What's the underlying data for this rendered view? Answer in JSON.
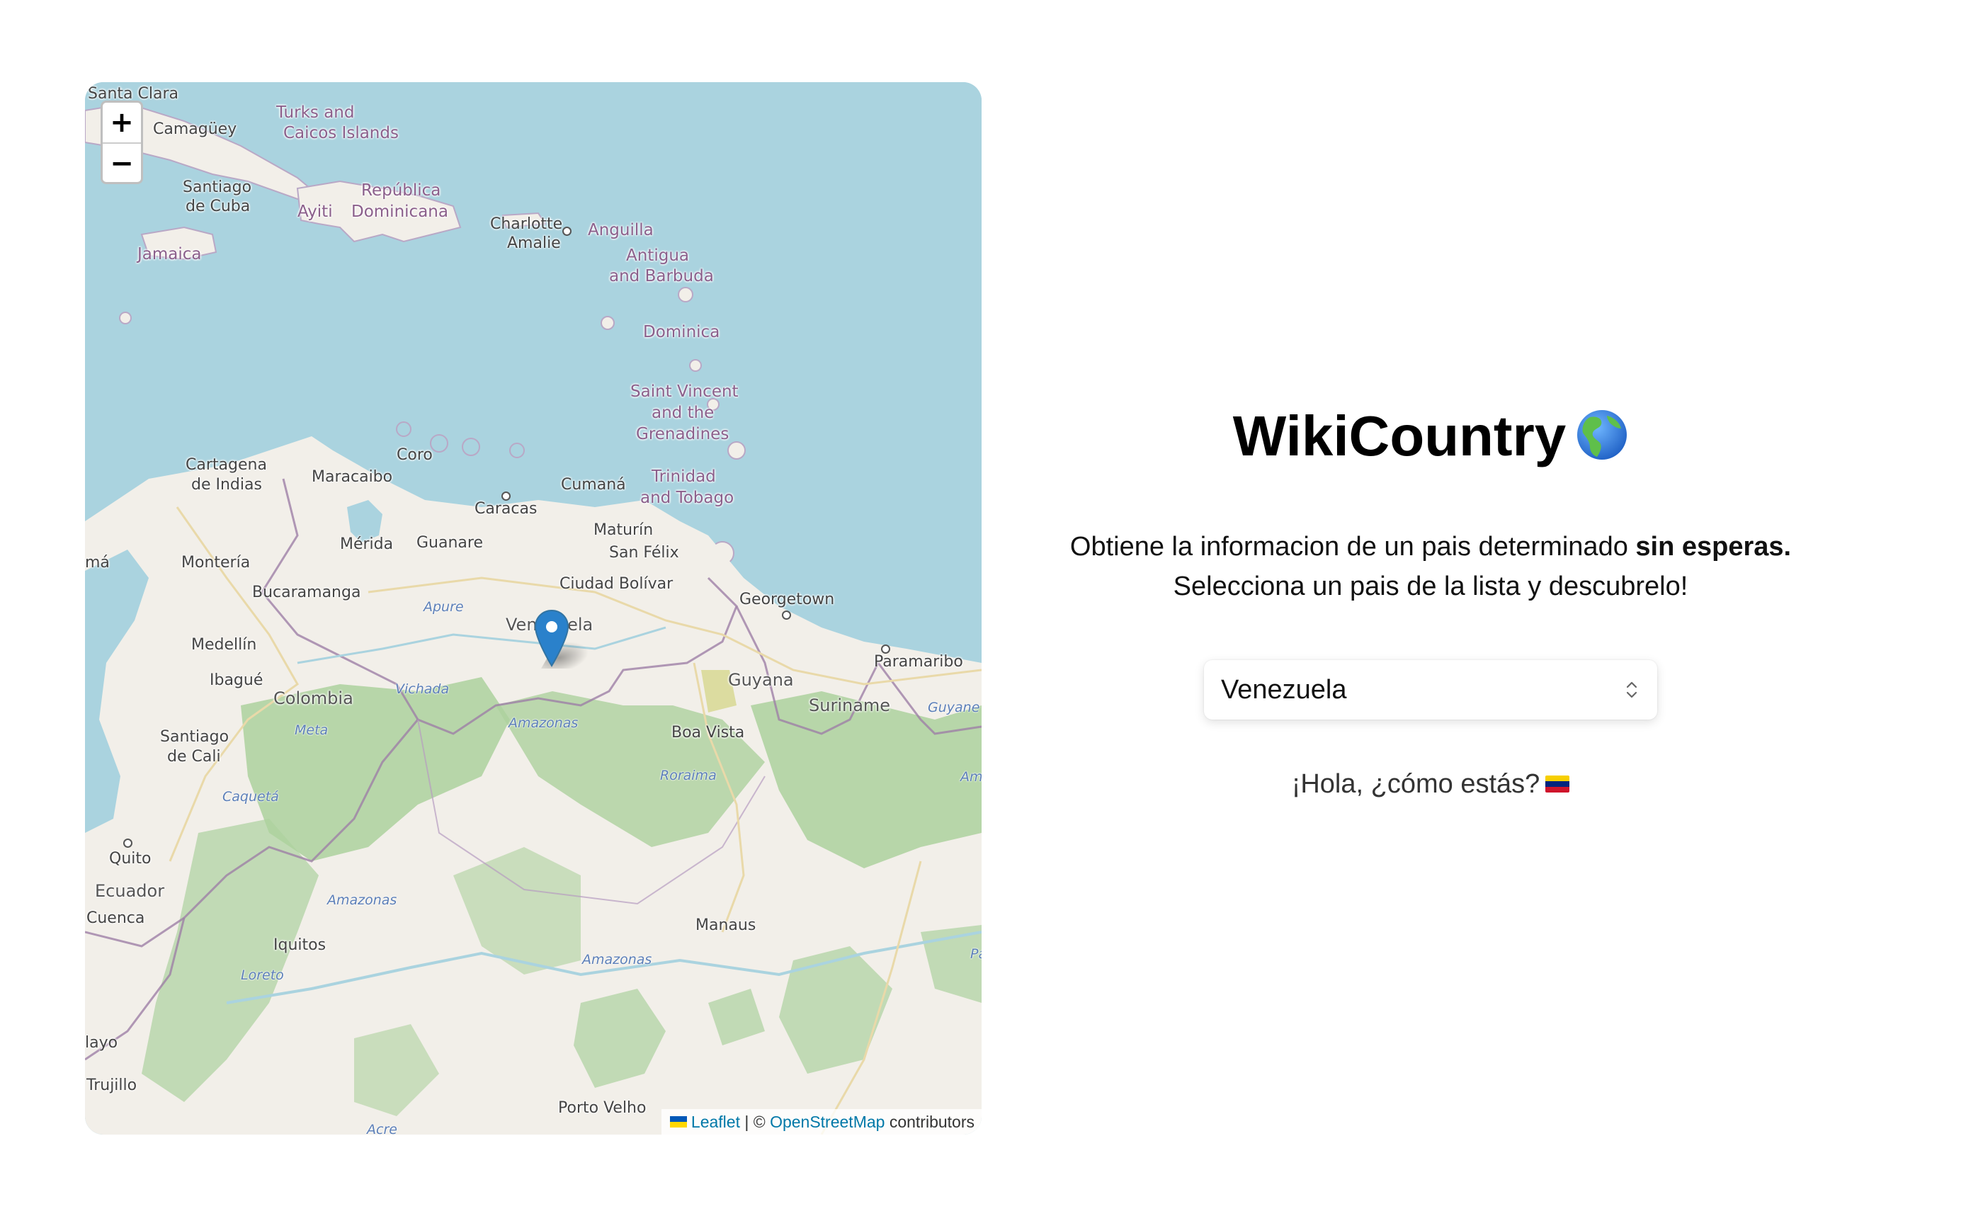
{
  "app": {
    "title": "WikiCountry",
    "title_icon": "globe-americas-icon",
    "description_line1": "Obtiene la informacion de un pais determinado",
    "description_emphasis": "sin esperas.",
    "description_line2": "Selecciona un pais de la lista y descubrelo!",
    "greeting": "¡Hola, ¿cómo estás?",
    "greeting_icon": "venezuela-flag-icon"
  },
  "country_select": {
    "selected": "Venezuela"
  },
  "map": {
    "zoom_in_label": "+",
    "zoom_out_label": "−",
    "marker_icon": "map-pin-icon",
    "attribution": {
      "leaflet": "Leaflet",
      "separator": "| ©",
      "osm": "OpenStreetMap",
      "suffix": "contributors"
    },
    "labels": {
      "santa_clara": "Santa Clara",
      "camaguey": "Camagüey",
      "turks1": "Turks and",
      "turks2": "Caicos Islands",
      "santiago1": "Santiago",
      "santiago2": "de Cuba",
      "republica1": "República",
      "republica2": "Dominicana",
      "ayiti": "Ayiti",
      "charlotte1": "Charlotte",
      "charlotte2": "Amalie",
      "anguilla": "Anguilla",
      "jamaica": "Jamaica",
      "antigua1": "Antigua",
      "antigua2": "and Barbuda",
      "dominica": "Dominica",
      "stvincent1": "Saint Vincent",
      "stvincent2": "and the",
      "stvincent3": "Grenadines",
      "cartagena1": "Cartagena",
      "cartagena2": "de Indias",
      "coro": "Coro",
      "maracaibo": "Maracaibo",
      "cumana": "Cumaná",
      "trinidad1": "Trinidad",
      "trinidad2": "and Tobago",
      "caracas": "Caracas",
      "merida": "Mérida",
      "guanare": "Guanare",
      "maturin": "Maturín",
      "sanfelix": "San Félix",
      "ma": "má",
      "monteria": "Montería",
      "ciudadbolivar": "Ciudad Bolívar",
      "bucaramanga": "Bucaramanga",
      "apure": "Apure",
      "venezuela": "Venezuela",
      "georgetown": "Georgetown",
      "medellin": "Medellín",
      "paramaribo": "Paramaribo",
      "ibague": "Ibagué",
      "colombia": "Colombia",
      "vichada": "Vichada",
      "guyana": "Guyana",
      "suriname": "Suriname",
      "guyane": "Guyane",
      "amazonas_ve": "Amazonas",
      "boavista": "Boa Vista",
      "meta": "Meta",
      "santiagocali1": "Santiago",
      "santiagocali2": "de Cali",
      "roraima": "Roraima",
      "caqueta": "Caquetá",
      "am": "Am",
      "quito": "Quito",
      "ecuador": "Ecuador",
      "cuenca": "Cuenca",
      "amazonas_co": "Amazonas",
      "iquitos": "Iquitos",
      "manaus": "Manaus",
      "amazonas_br": "Amazonas",
      "loreto": "Loreto",
      "pa": "Pa",
      "layo": "layo",
      "trujillo": "Trujillo",
      "portovelho": "Porto Velho",
      "acre": "Acre"
    }
  }
}
